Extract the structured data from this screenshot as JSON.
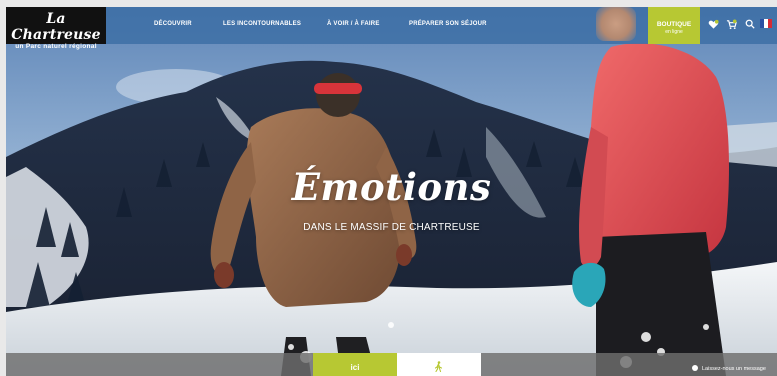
{
  "site": {
    "logo_title": "La Chartreuse",
    "logo_subtitle": "un Parc naturel régional"
  },
  "nav": {
    "items": [
      {
        "label": "DÉCOUVRIR"
      },
      {
        "label": "LES INCONTOURNABLES"
      },
      {
        "label": "À VOIR / À FAIRE"
      },
      {
        "label": "PRÉPARER SON SÉJOUR"
      }
    ]
  },
  "shop": {
    "label": "BOUTIQUE",
    "sublabel": "en ligne"
  },
  "header_icons": [
    "favorites-icon",
    "cart-icon",
    "search-icon",
    "french-flag-icon"
  ],
  "hero": {
    "title": "Émotions",
    "subtitle": "DANS LE MASSIF DE CHARTREUSE"
  },
  "bottom": {
    "tab_label": "ici",
    "corner_text": "Laissez-nous un message"
  },
  "colors": {
    "accent": "#b7c833",
    "header": "#3c6ea5",
    "logo_bg": "#111111"
  }
}
